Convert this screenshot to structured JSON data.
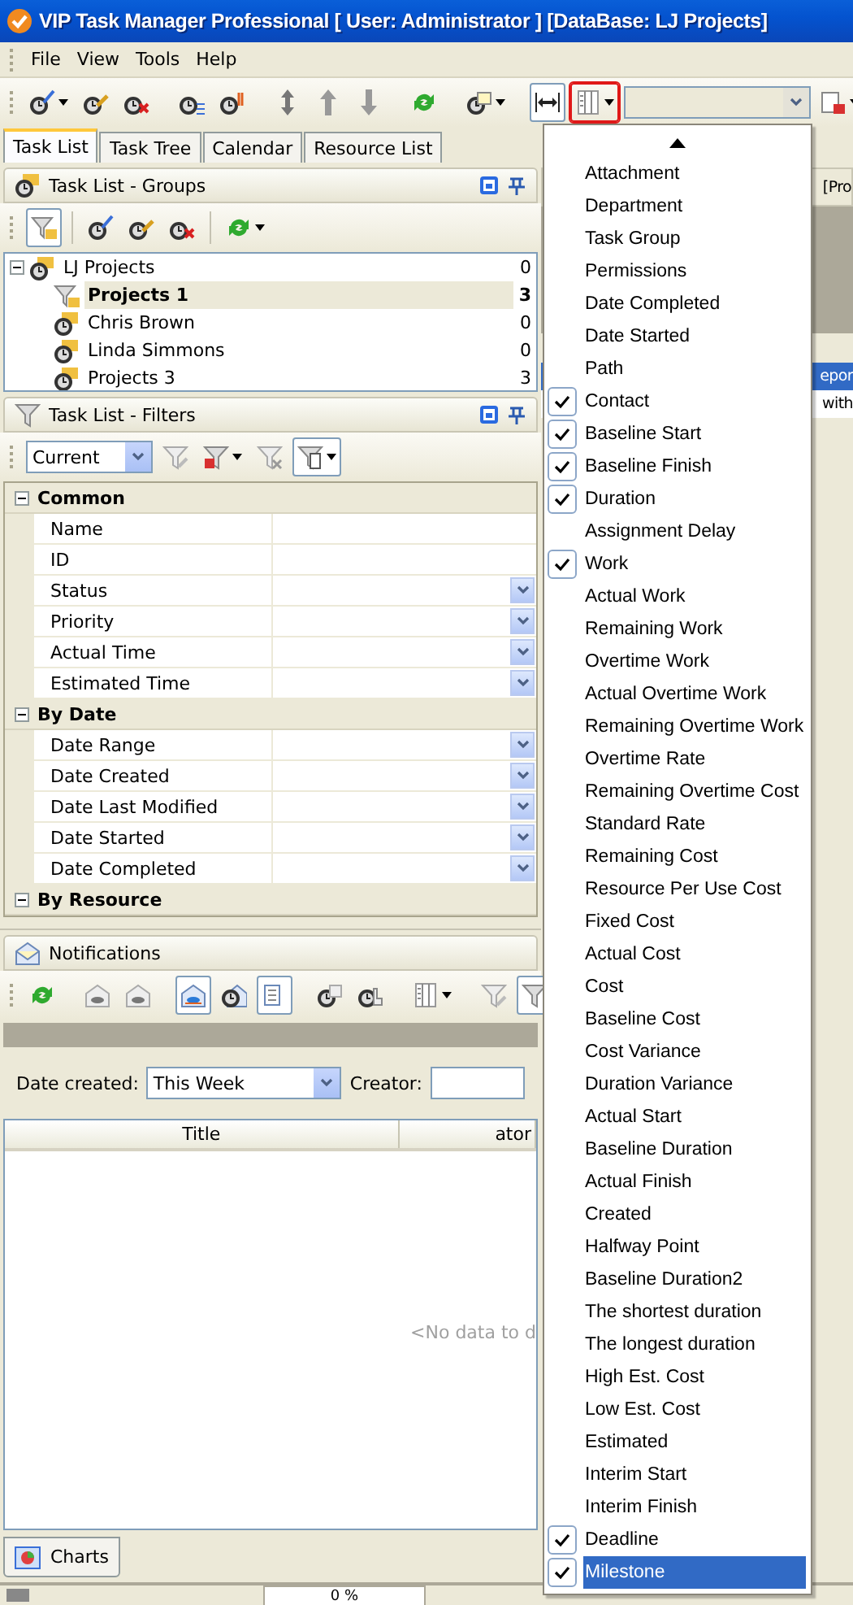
{
  "window": {
    "title": "VIP Task Manager Professional [ User: Administrator ] [DataBase: LJ Projects]"
  },
  "menu_bar": [
    "File",
    "View",
    "Tools",
    "Help"
  ],
  "tabs": [
    {
      "label": "Task List",
      "selected": true
    },
    {
      "label": "Task Tree",
      "selected": false
    },
    {
      "label": "Calendar",
      "selected": false
    },
    {
      "label": "Resource List",
      "selected": false
    }
  ],
  "groups_panel": {
    "title": "Task List - Groups",
    "tree": [
      {
        "label": "LJ Projects",
        "count": "0",
        "kind": "group",
        "selected": false,
        "expanded": true,
        "children": [
          {
            "label": "Projects 1",
            "count": "3",
            "kind": "filter",
            "selected": true
          },
          {
            "label": "Chris Brown",
            "count": "0",
            "kind": "group",
            "selected": false
          },
          {
            "label": "Linda Simmons",
            "count": "0",
            "kind": "group",
            "selected": false
          },
          {
            "label": "Projects 3",
            "count": "3",
            "kind": "group",
            "selected": false
          }
        ]
      }
    ]
  },
  "filters_panel": {
    "title": "Task List - Filters",
    "preset": "Current",
    "categories": [
      {
        "label": "Common",
        "expanded": true,
        "fields": [
          {
            "label": "Name",
            "dropdown": false
          },
          {
            "label": "ID",
            "dropdown": false
          },
          {
            "label": "Status",
            "dropdown": true
          },
          {
            "label": "Priority",
            "dropdown": true
          },
          {
            "label": "Actual Time",
            "dropdown": true
          },
          {
            "label": "Estimated Time",
            "dropdown": true
          }
        ]
      },
      {
        "label": "By Date",
        "expanded": true,
        "fields": [
          {
            "label": "Date Range",
            "dropdown": true
          },
          {
            "label": "Date Created",
            "dropdown": true
          },
          {
            "label": "Date Last Modified",
            "dropdown": true
          },
          {
            "label": "Date Started",
            "dropdown": true
          },
          {
            "label": "Date Completed",
            "dropdown": true
          }
        ]
      },
      {
        "label": "By Resource",
        "expanded": true
      }
    ]
  },
  "notifications": {
    "title": "Notifications",
    "date_created_label": "Date created:",
    "date_created": "This Week",
    "creator_label": "Creator:",
    "columns": [
      "Title",
      "ator"
    ],
    "empty_text": "<No data to d"
  },
  "right_pane": {
    "header_text": "[Pro",
    "rows": [
      {
        "text": "epor",
        "selected": true
      },
      {
        "text": "with",
        "selected": false
      }
    ]
  },
  "bottom_tabs": [
    {
      "label": "Charts",
      "selected": true
    }
  ],
  "status_bar": {
    "progress": "0 %"
  },
  "columns_menu": {
    "open": true,
    "items": [
      {
        "label": "Attachment",
        "checked": false,
        "selected": false
      },
      {
        "label": "Department",
        "checked": false,
        "selected": false
      },
      {
        "label": "Task Group",
        "checked": false,
        "selected": false
      },
      {
        "label": "Permissions",
        "checked": false,
        "selected": false
      },
      {
        "label": "Date Completed",
        "checked": false,
        "selected": false
      },
      {
        "label": "Date Started",
        "checked": false,
        "selected": false
      },
      {
        "label": "Path",
        "checked": false,
        "selected": false
      },
      {
        "label": "Contact",
        "checked": true,
        "selected": false
      },
      {
        "label": "Baseline Start",
        "checked": true,
        "selected": false
      },
      {
        "label": "Baseline Finish",
        "checked": true,
        "selected": false
      },
      {
        "label": "Duration",
        "checked": true,
        "selected": false
      },
      {
        "label": "Assignment Delay",
        "checked": false,
        "selected": false
      },
      {
        "label": "Work",
        "checked": true,
        "selected": false
      },
      {
        "label": "Actual Work",
        "checked": false,
        "selected": false
      },
      {
        "label": "Remaining Work",
        "checked": false,
        "selected": false
      },
      {
        "label": "Overtime Work",
        "checked": false,
        "selected": false
      },
      {
        "label": "Actual Overtime Work",
        "checked": false,
        "selected": false
      },
      {
        "label": "Remaining Overtime Work",
        "checked": false,
        "selected": false
      },
      {
        "label": "Overtime Rate",
        "checked": false,
        "selected": false
      },
      {
        "label": "Remaining Overtime Cost",
        "checked": false,
        "selected": false
      },
      {
        "label": "Standard Rate",
        "checked": false,
        "selected": false
      },
      {
        "label": "Remaining Cost",
        "checked": false,
        "selected": false
      },
      {
        "label": "Resource Per Use Cost",
        "checked": false,
        "selected": false
      },
      {
        "label": "Fixed Cost",
        "checked": false,
        "selected": false
      },
      {
        "label": "Actual Cost",
        "checked": false,
        "selected": false
      },
      {
        "label": "Cost",
        "checked": false,
        "selected": false
      },
      {
        "label": "Baseline Cost",
        "checked": false,
        "selected": false
      },
      {
        "label": "Cost Variance",
        "checked": false,
        "selected": false
      },
      {
        "label": "Duration Variance",
        "checked": false,
        "selected": false
      },
      {
        "label": "Actual Start",
        "checked": false,
        "selected": false
      },
      {
        "label": "Baseline Duration",
        "checked": false,
        "selected": false
      },
      {
        "label": "Actual Finish",
        "checked": false,
        "selected": false
      },
      {
        "label": "Created",
        "checked": false,
        "selected": false
      },
      {
        "label": "Halfway Point",
        "checked": false,
        "selected": false
      },
      {
        "label": "Baseline Duration2",
        "checked": false,
        "selected": false
      },
      {
        "label": "The shortest duration",
        "checked": false,
        "selected": false
      },
      {
        "label": "The longest duration",
        "checked": false,
        "selected": false
      },
      {
        "label": "High Est. Cost",
        "checked": false,
        "selected": false
      },
      {
        "label": "Low Est. Cost",
        "checked": false,
        "selected": false
      },
      {
        "label": "Estimated",
        "checked": false,
        "selected": false
      },
      {
        "label": "Interim Start",
        "checked": false,
        "selected": false
      },
      {
        "label": "Interim Finish",
        "checked": false,
        "selected": false
      },
      {
        "label": "Deadline",
        "checked": true,
        "selected": false
      },
      {
        "label": "Milestone",
        "checked": true,
        "selected": true
      }
    ]
  }
}
